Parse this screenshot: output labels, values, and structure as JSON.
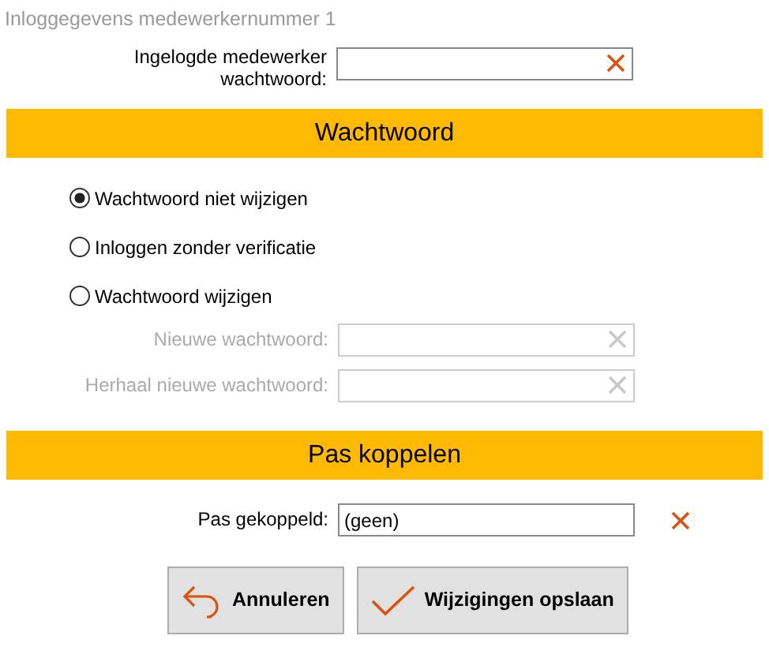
{
  "window": {
    "title": "Inloggegevens medewerkernummer 1"
  },
  "login_field": {
    "label": "Ingelogde medewerker wachtwoord:",
    "disabled": false
  },
  "sections": [
    {
      "title": "Wachtwoord"
    },
    {
      "title": "Pas koppelen"
    }
  ],
  "password_options": [
    {
      "label": "Wachtwoord niet wijzigen",
      "selected": true
    },
    {
      "label": "Inloggen zonder verificatie",
      "selected": false
    },
    {
      "label": "Wachtwoord wijzigen",
      "selected": false
    }
  ],
  "password_fields": [
    {
      "label": "Nieuwe wachtwoord:",
      "disabled": true
    },
    {
      "label": "Herhaal nieuwe wachtwoord:",
      "disabled": true
    }
  ],
  "card_field": {
    "label": "Pas gekoppeld:",
    "value": "(geen)",
    "disabled": false
  },
  "buttons": [
    {
      "label": "Annuleren",
      "kind": "cancel"
    },
    {
      "label": "Wijzigingen opslaan",
      "kind": "save"
    }
  ]
}
